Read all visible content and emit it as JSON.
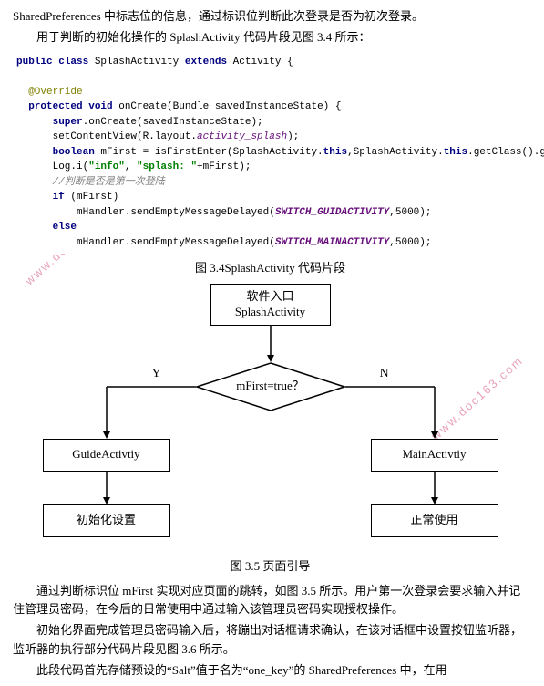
{
  "intro": {
    "line1": "SharedPreferences 中标志位的信息，通过标识位判断此次登录是否为初次登录。",
    "line2": "用于判断的初始化操作的 SplashActivity 代码片段见图 3.4 所示："
  },
  "code": {
    "l1_kw1": "public class ",
    "l1_cls": "SplashActivity ",
    "l1_kw2": "extends ",
    "l1_sup": "Activity {",
    "l2_ann": "@Override",
    "l3_kw1": "protected void ",
    "l3_fn": "onCreate(Bundle savedInstanceState) {",
    "l4_kw": "super",
    "l4_rest": ".onCreate(savedInstanceState);",
    "l5_a": "setContentView(R.layout.",
    "l5_ital": "activity_splash",
    "l5_b": ");",
    "l6_kw": "boolean ",
    "l6_a": "mFirst = isFirstEnter(SplashActivity.",
    "l6_kw2": "this",
    "l6_b": ",SplashActivity.",
    "l6_kw3": "this",
    "l6_c": ".getClass().getName());",
    "l7_a": "Log.i(",
    "l7_s1": "\"info\"",
    "l7_b": ", ",
    "l7_s2": "\"splash: \"",
    "l7_c": "+mFirst);",
    "l8_cmt": "//判断是否是第一次登陆",
    "l9_kw": "if ",
    "l9_rest": "(mFirst)",
    "l10_a": "mHandler.sendEmptyMessageDelayed(",
    "l10_const": "SWITCH_GUIDACTIVITY",
    "l10_b": ",5000);",
    "l11_kw": "else",
    "l12_a": "mHandler.sendEmptyMessageDelayed(",
    "l12_const": "SWITCH_MAINACTIVITY",
    "l12_b": ",5000);"
  },
  "caption1": "图 3.4SplashActivity 代码片段",
  "flow": {
    "entry_l1": "软件入口",
    "entry_l2": "SplashActivity",
    "decision": "mFirst=true？",
    "yes": "Y",
    "no": "N",
    "guide": "GuideActivtiy",
    "main": "MainActivtiy",
    "init_setup": "初始化设置",
    "normal_use": "正常使用"
  },
  "caption2": "图 3.5 页面引导",
  "body": {
    "p1": "通过判断标识位 mFirst 实现对应页面的跳转，如图 3.5 所示。用户第一次登录会要求输入并记住管理员密码，在今后的日常使用中通过输入该管理员密码实现授权操作。",
    "p2": "初始化界面完成管理员密码输入后，将蹦出对话框请求确认，在该对话框中设置按钮监听器，监听器的执行部分代码片段见图 3.6 所示。",
    "p3": "此段代码首先存储预设的“Salt”值于名为“one_key”的 SharedPreferences 中，在用"
  },
  "watermark": "www.doc163.com"
}
